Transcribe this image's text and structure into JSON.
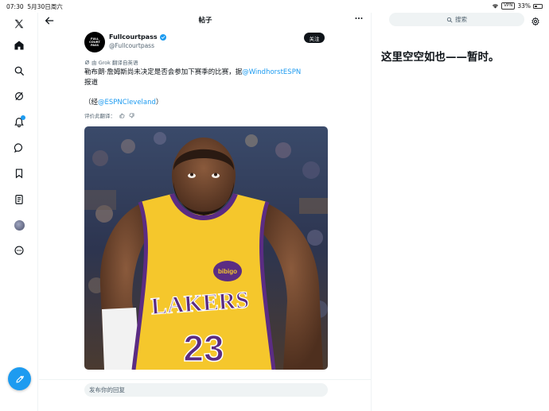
{
  "status_bar": {
    "time": "07:30",
    "date": "5月30日周六",
    "vpn": "VPN",
    "battery": "33%"
  },
  "sidebar": {
    "items": [
      {
        "icon": "x-logo-icon"
      },
      {
        "icon": "home-icon"
      },
      {
        "icon": "search-icon"
      },
      {
        "icon": "grok-icon"
      },
      {
        "icon": "notifications-icon"
      },
      {
        "icon": "messages-icon"
      },
      {
        "icon": "bookmarks-icon"
      },
      {
        "icon": "lists-icon"
      },
      {
        "icon": "profile-avatar-icon"
      },
      {
        "icon": "more-icon"
      }
    ],
    "compose_icon": "compose-icon"
  },
  "header": {
    "title": "帖子"
  },
  "post": {
    "author_name": "Fullcourtpass",
    "author_handle": "@Fullcourtpass",
    "avatar_text": [
      "FULL",
      "COURT",
      "PASS"
    ],
    "follow_label": "关注",
    "translated_note": "由 Grok 翻译自英语",
    "text_before_link": "勒布朗·詹姆斯尚未决定是否会参加下赛季的比赛，据",
    "mention_1": "@WindhorstESPN",
    "text_after_link": "报道",
    "via_open": "（经",
    "mention_2": "@ESPNCleveland",
    "via_close": "）",
    "rate_translation": "评价此翻译：",
    "image": {
      "jersey_team": "LAKERS",
      "jersey_number": "23",
      "patch": "bibigo",
      "jersey_color": "#f5c72c",
      "trim_color": "#5b2c83"
    }
  },
  "reply": {
    "placeholder": "发布你的回复"
  },
  "right_panel": {
    "search_placeholder": "搜索",
    "empty_message": "这里空空如也——暂时。"
  },
  "colors": {
    "accent": "#1d9bf0",
    "text": "#0f1419",
    "secondary": "#536471",
    "surface": "#eff3f4"
  }
}
